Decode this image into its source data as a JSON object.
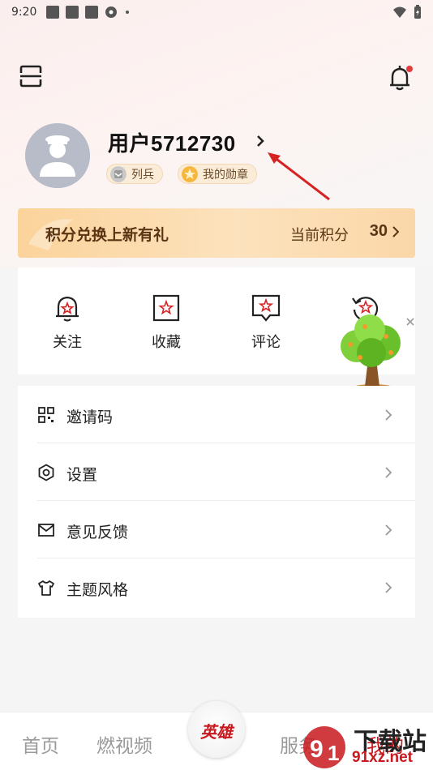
{
  "status_bar": {
    "time": "9:20"
  },
  "header": {
    "scan_icon": "scan-icon",
    "bell_icon": "bell-icon"
  },
  "profile": {
    "username": "用户5712730",
    "rank_label": "列兵",
    "medal_label": "我的勋章"
  },
  "points_banner": {
    "title": "积分兑换上新有礼",
    "current_label": "当前积分",
    "current_value": "30"
  },
  "quick_actions": [
    {
      "label": "关注",
      "icon": "bell-star-icon"
    },
    {
      "label": "收藏",
      "icon": "star-box-icon"
    },
    {
      "label": "评论",
      "icon": "comment-star-icon"
    }
  ],
  "menu": [
    {
      "label": "邀请码",
      "icon": "qr-grid-icon"
    },
    {
      "label": "设置",
      "icon": "hexagon-settings-icon"
    },
    {
      "label": "意见反馈",
      "icon": "envelope-icon"
    },
    {
      "label": "主题风格",
      "icon": "tshirt-icon"
    }
  ],
  "tabbar": {
    "home": "首页",
    "video": "燃视频",
    "center": "英雄",
    "service": "服务",
    "mine": "我的"
  },
  "watermark": {
    "text": "下载站",
    "url": "91xz.net"
  },
  "colors": {
    "accent": "#c8191e",
    "banner": "#fbd39b",
    "badge_notify": "#e23b3b"
  }
}
